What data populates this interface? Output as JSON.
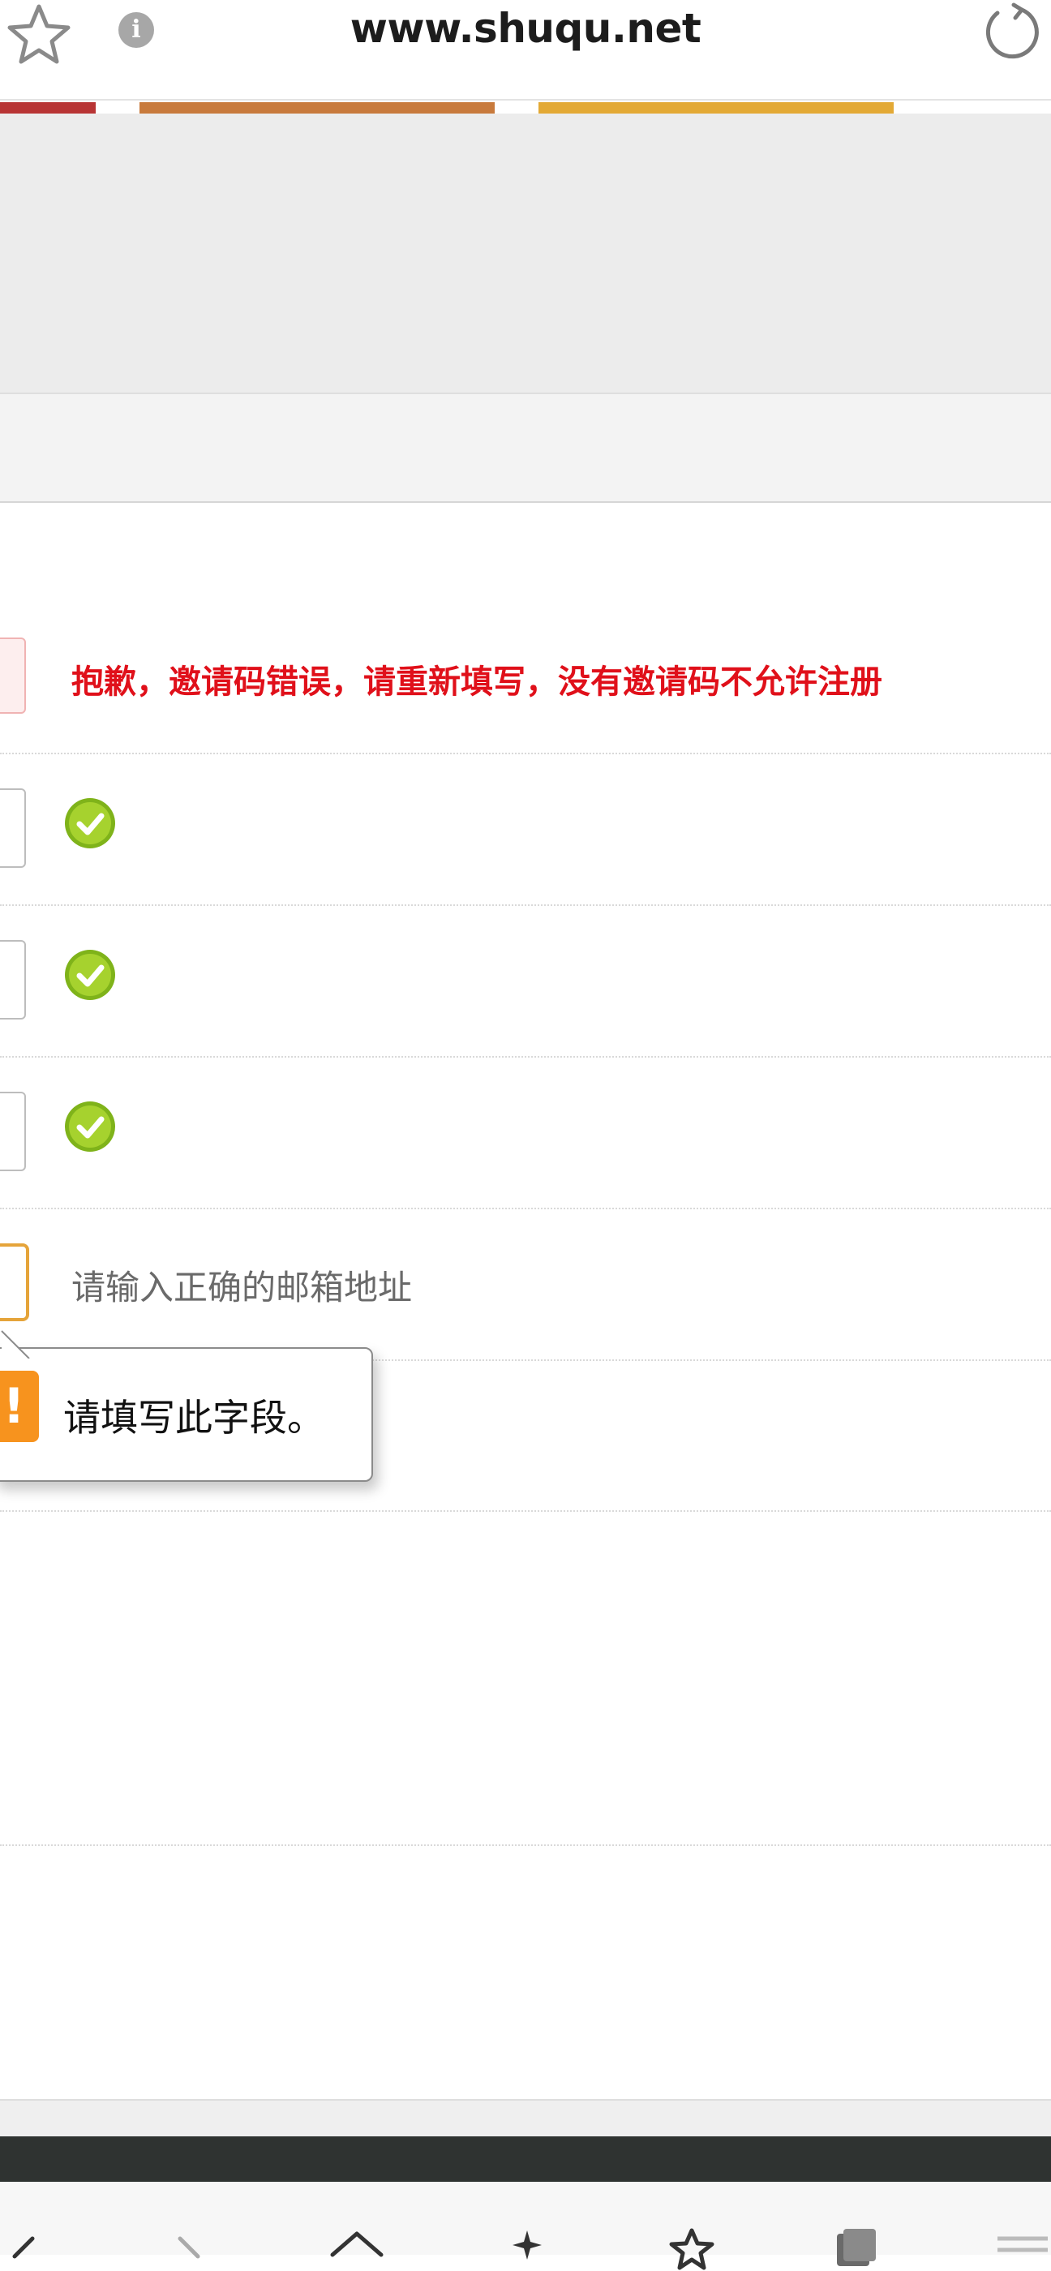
{
  "browser": {
    "url": "www.shuqu.net",
    "icons": [
      "bookmark-star-icon",
      "info-icon",
      "reload-icon"
    ],
    "info_glyph": "i"
  },
  "stripes": {
    "colors": [
      "#b83434",
      "#c87a3c",
      "#e3a935"
    ]
  },
  "form": {
    "invite_error": "抱歉，邀请码错误，请重新填写，没有邀请码不允许注册",
    "email_hint": "请输入正确的邮箱地址",
    "valid_icon": "checkmark-circle-icon"
  },
  "tooltip": {
    "icon_glyph": "!",
    "message": "请填写此字段。"
  },
  "colors": {
    "error_text": "#e0101a",
    "valid_green": "#8dc21f",
    "focus_orange": "#e5a43a",
    "tooltip_icon": "#f7931e"
  },
  "toolbar": {
    "icons": [
      "back-icon",
      "forward-icon",
      "home-icon",
      "sparkle-icon",
      "favorites-icon",
      "tabs-icon",
      "menu-icon"
    ]
  }
}
